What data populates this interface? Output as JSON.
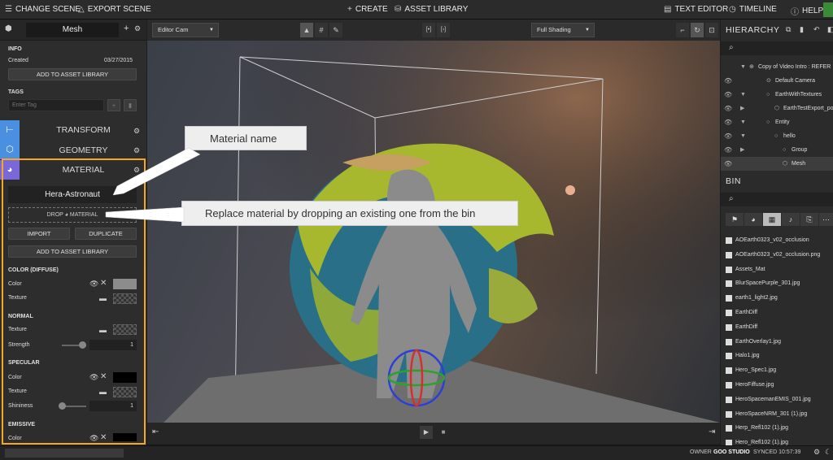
{
  "topbar": {
    "change_scene": "CHANGE SCENE",
    "export_scene": "EXPORT SCENE",
    "create": "CREATE",
    "asset_library": "ASSET LIBRARY",
    "text_editor": "TEXT EDITOR",
    "timeline": "TIMELINE",
    "help": "HELP"
  },
  "left": {
    "entity_name": "Mesh",
    "info_head": "INFO",
    "created_label": "Created",
    "created_date": "03/27/2015",
    "add_asset_1": "ADD TO ASSET LIBRARY",
    "tags_head": "TAGS",
    "tag_placeholder": "Enter Tag",
    "transform": "TRANSFORM",
    "geometry": "GEOMETRY",
    "material": "MATERIAL",
    "material_name": "Hera-Astronaut",
    "drop_label": "DROP",
    "drop_material": "MATERIAL",
    "import": "IMPORT",
    "duplicate": "DUPLICATE",
    "add_asset_2": "ADD TO ASSET LIBRARY",
    "color_diffuse": "COLOR (DIFFUSE)",
    "color": "Color",
    "texture": "Texture",
    "normal": "NORMAL",
    "strength": "Strength",
    "strength_value": "1",
    "specular": "SPECULAR",
    "shininess": "Shininess",
    "shininess_value": "1",
    "emissive": "EMISSIVE",
    "diffuse_color": "#8c8c8c",
    "specular_color": "#000000",
    "emissive_color": "#000000"
  },
  "viewport": {
    "camera": "Editor Cam",
    "shading": "Full Shading"
  },
  "callouts": {
    "material_name": "Material name",
    "replace": "Replace material by dropping an existing one from the bin"
  },
  "right": {
    "hierarchy": "HIERARCHY",
    "tree": [
      {
        "label": "Copy of Video Intro : REFER",
        "eye": false
      },
      {
        "label": "Default Camera",
        "eye": true
      },
      {
        "label": "EarthWithTextures",
        "eye": true
      },
      {
        "label": "EarthTestExport_poly",
        "eye": true
      },
      {
        "label": "Entity",
        "eye": true
      },
      {
        "label": "hello",
        "eye": true
      },
      {
        "label": "Group",
        "eye": true
      },
      {
        "label": "Mesh",
        "eye": true
      }
    ],
    "bin": "BIN",
    "files": [
      "AOEarth0323_v02_occlusion",
      "AOEarth0323_v02_occlusion.png",
      "Assets_Mat",
      "BlurSpacePurple_301.jpg",
      "earth1_light2.jpg",
      "EarthDiff",
      "EarthDiff",
      "EarthOverlay1.jpg",
      "Halo1.jpg",
      "Hero_Spec1.jpg",
      "HeroFiffuse.jpg",
      "HeroSpacemanEMIS_001.jpg",
      "HeroSpaceNRM_301 (1).jpg",
      "Herp_Refl102 (1).jpg",
      "Hero_Refl102 (1).jpg"
    ]
  },
  "status": {
    "owner": "OWNER",
    "studio": "GOO STUDIO",
    "synced": "SYNCED 10:57:39"
  }
}
